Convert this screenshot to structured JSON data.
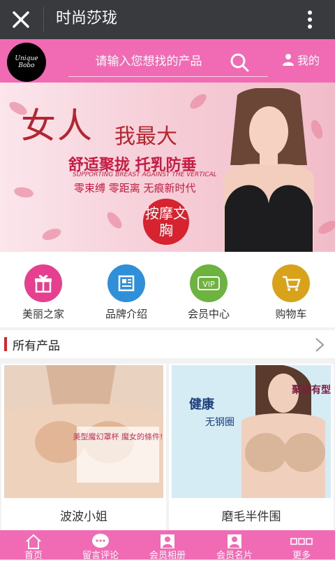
{
  "window": {
    "title": "时尚莎珑"
  },
  "brand": {
    "logo_text": "Unique Bobo"
  },
  "search": {
    "placeholder": "请输入您想找的产品",
    "mine_label": "我的"
  },
  "banner": {
    "headline_big": "女人",
    "headline_small": "我最大",
    "slogan": "舒适聚拢 托乳防垂",
    "slogan_en": "SUPPORTING BREAST AGAINST THE VERTICAL",
    "features": "零束缚 零距离 无痕新时代",
    "badge": "按摩文胸"
  },
  "nav": {
    "items": [
      {
        "label": "美丽之家",
        "icon": "gift-icon",
        "color": "#e63f8f"
      },
      {
        "label": "品牌介绍",
        "icon": "newspaper-icon",
        "color": "#2f8fd8"
      },
      {
        "label": "会员中心",
        "icon": "vip-icon",
        "color": "#6db33f"
      },
      {
        "label": "购物车",
        "icon": "cart-icon",
        "color": "#d9a21b"
      }
    ]
  },
  "section": {
    "title": "所有产品"
  },
  "products": [
    {
      "name": "波波小姐",
      "promo_title": "美型魔幻罩杯 魔女的條件!"
    },
    {
      "name": "磨毛半件围",
      "promo_left": "健康",
      "promo_left2": "无钢圈",
      "promo_right": "聚拢有型"
    }
  ],
  "tabbar": {
    "items": [
      {
        "label": "首页",
        "icon": "home-icon"
      },
      {
        "label": "留言评论",
        "icon": "chat-icon"
      },
      {
        "label": "会员相册",
        "icon": "photo-icon"
      },
      {
        "label": "会员名片",
        "icon": "contact-card-icon"
      },
      {
        "label": "更多",
        "icon": "more-icon"
      }
    ]
  },
  "colors": {
    "accent": "#f06bb4",
    "titlebar": "#393a3e",
    "section_marker": "#e0202a"
  }
}
